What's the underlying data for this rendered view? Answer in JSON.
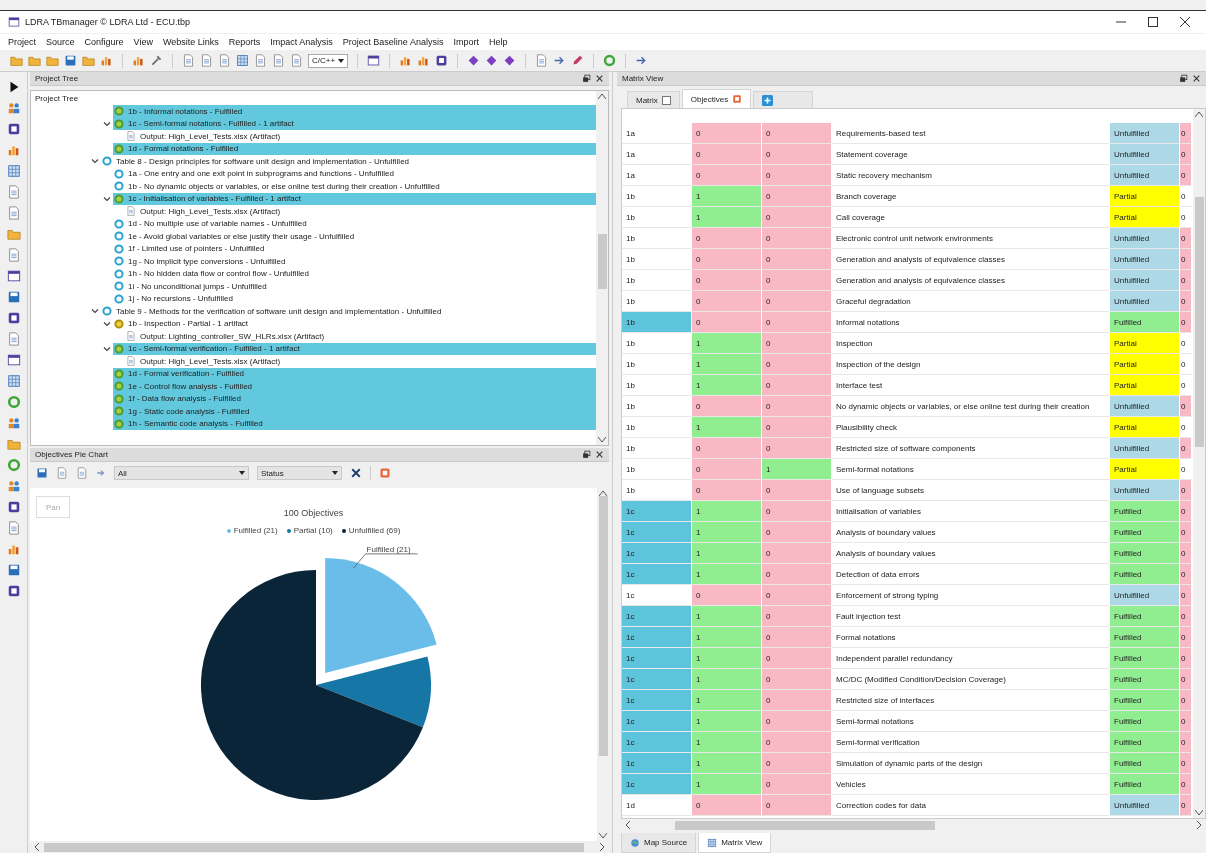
{
  "window": {
    "title": "LDRA TBmanager © LDRA Ltd - ECU.tbp"
  },
  "menu": [
    "Project",
    "Source",
    "Configure",
    "View",
    "Website Links",
    "Reports",
    "Impact Analysis",
    "Project Baseline Analysis",
    "Import",
    "Help"
  ],
  "toolbar": {
    "language": "C/C++"
  },
  "project_tree": {
    "title": "Project Tree",
    "column": "Project Tree",
    "items": [
      {
        "children": [
          {
            "label": "1b - Informal notations  - Fulfilled",
            "kind": "fulfilled",
            "selected": true
          },
          {
            "label": "1c - Semi-formal notations  - Fulfilled - 1 artifact",
            "kind": "fulfilled",
            "selected": true,
            "expanded": true,
            "children": [
              {
                "label": "Output: High_Level_Tests.xlsx (Artifact)",
                "kind": "artifact",
                "selected": false
              }
            ]
          },
          {
            "label": "1d - Formal notations  - Fulfilled",
            "kind": "fulfilled",
            "selected": true
          }
        ]
      },
      {
        "label": "Table 8 - Design principles for software unit design and implementation - Unfulfilled",
        "kind": "unfulfilled",
        "selected": false,
        "expanded": true,
        "children": [
          {
            "label": "1a - One entry and one exit point in subprograms and functions - Unfulfilled",
            "kind": "unfulfilled",
            "selected": false
          },
          {
            "label": "1b - No dynamic objects or variables, or else online test during their creation - Unfulfilled",
            "kind": "unfulfilled",
            "selected": false
          },
          {
            "label": "1c -  Initialisation of variables - Fulfilled - 1 artifact",
            "kind": "fulfilled",
            "selected": true,
            "expanded": true,
            "children": [
              {
                "label": "Output: High_Level_Tests.xlsx (Artifact)",
                "kind": "artifact",
                "selected": false
              }
            ]
          },
          {
            "label": "1d - No multiple use of variable names - Unfulfilled",
            "kind": "unfulfilled",
            "selected": false
          },
          {
            "label": "1e - Avoid global variables or else justify their usage - Unfulfilled",
            "kind": "unfulfilled",
            "selected": false
          },
          {
            "label": "1f - Limited use of pointers - Unfulfilled",
            "kind": "unfulfilled",
            "selected": false
          },
          {
            "label": "1g - No implicit type conversions - Unfulfilled",
            "kind": "unfulfilled",
            "selected": false
          },
          {
            "label": "1h - No hidden data flow or control flow - Unfulfilled",
            "kind": "unfulfilled",
            "selected": false
          },
          {
            "label": "1i - No unconditional jumps - Unfulfilled",
            "kind": "unfulfilled",
            "selected": false
          },
          {
            "label": "1j - No recursions - Unfulfilled",
            "kind": "unfulfilled",
            "selected": false
          }
        ]
      },
      {
        "label": "Table 9 -  Methods for the verification of software unit design and implementation - Unfulfilled",
        "kind": "unfulfilled",
        "selected": false,
        "expanded": true,
        "children": [
          {
            "label": "1b - Inspection - Partial - 1 artifact",
            "kind": "partial",
            "selected": false,
            "expanded": true,
            "children": [
              {
                "label": "Output: Lighting_controller_SW_HLRs.xlsx (Artifact)",
                "kind": "artifact",
                "selected": false
              }
            ]
          },
          {
            "label": "1c - Semi-formal verification - Fulfilled - 1 artifact",
            "kind": "fulfilled",
            "selected": true,
            "expanded": true,
            "children": [
              {
                "label": "Output: High_Level_Tests.xlsx (Artifact)",
                "kind": "artifact",
                "selected": false
              }
            ]
          },
          {
            "label": "1d - Formal verification  - Fulfilled",
            "kind": "fulfilled",
            "selected": true
          },
          {
            "label": "1e - Control flow analysis  - Fulfilled",
            "kind": "fulfilled",
            "selected": true
          },
          {
            "label": "1f - Data flow analysis  - Fulfilled",
            "kind": "fulfilled",
            "selected": true
          },
          {
            "label": "1g - Static code analysis - Fulfilled",
            "kind": "fulfilled",
            "selected": true
          },
          {
            "label": "1h - Semantic code analysis - Fulfilled",
            "kind": "fulfilled",
            "selected": true
          }
        ]
      }
    ]
  },
  "pie_chart_panel": {
    "title": "Objectives Pie Chart",
    "filters": [
      {
        "value": "All"
      },
      {
        "value": "Status"
      }
    ],
    "pan_button": "Pan",
    "legend": [
      {
        "color": "#6bbde9"
      },
      {
        "color": "#1677a6"
      },
      {
        "color": "#0b2538"
      }
    ],
    "chart_data": {
      "type": "pie",
      "title": "100 Objectives",
      "categories": [
        "Fulfilled (21)",
        "Partial (10)",
        "Unfulfilled (69)"
      ],
      "values": [
        21,
        10,
        69
      ],
      "annotations": [
        {
          "text": "Fulfilled (21)"
        }
      ]
    }
  },
  "matrix_view": {
    "title": "Matrix View",
    "tabs": [
      {
        "kind": "view",
        "label": "Matrix",
        "selected": false
      },
      {
        "kind": "view",
        "label": "Objectives",
        "selected": true
      },
      {
        "kind": "add",
        "selected": false
      }
    ],
    "rows": [
      {
        "id": "1a",
        "highlighted": false,
        "column_2": "0",
        "column_2_met": false,
        "column_3": "0",
        "column_3_met": false,
        "objective": "Requirements-based test",
        "status": "Unfulfilled",
        "kind": "unfulfilled",
        "column_6": "0"
      },
      {
        "id": "1a",
        "highlighted": false,
        "column_2": "0",
        "column_2_met": false,
        "column_3": "0",
        "column_3_met": false,
        "objective": "Statement coverage",
        "status": "Unfulfilled",
        "kind": "unfulfilled",
        "column_6": "0"
      },
      {
        "id": "1a",
        "highlighted": false,
        "column_2": "0",
        "column_2_met": false,
        "column_3": "0",
        "column_3_met": false,
        "objective": "Static recovery mechanism",
        "status": "Unfulfilled",
        "kind": "unfulfilled",
        "column_6": "0"
      },
      {
        "id": "1b",
        "highlighted": false,
        "column_2": "1",
        "column_2_met": true,
        "column_3": "0",
        "column_3_met": false,
        "objective": "Branch coverage",
        "status": "Partial",
        "kind": "partial",
        "column_6": "0"
      },
      {
        "id": "1b",
        "highlighted": false,
        "column_2": "1",
        "column_2_met": true,
        "column_3": "0",
        "column_3_met": false,
        "objective": "Call coverage",
        "status": "Partial",
        "kind": "partial",
        "column_6": "0"
      },
      {
        "id": "1b",
        "highlighted": false,
        "column_2": "0",
        "column_2_met": false,
        "column_3": "0",
        "column_3_met": false,
        "objective": "Electronic control unit network environments",
        "status": "Unfulfilled",
        "kind": "unfulfilled",
        "column_6": "0"
      },
      {
        "id": "1b",
        "highlighted": false,
        "column_2": "0",
        "column_2_met": false,
        "column_3": "0",
        "column_3_met": false,
        "objective": "Generation and analysis of equivalence classes",
        "status": "Unfulfilled",
        "kind": "unfulfilled",
        "column_6": "0"
      },
      {
        "id": "1b",
        "highlighted": false,
        "column_2": "0",
        "column_2_met": false,
        "column_3": "0",
        "column_3_met": false,
        "objective": "Generation and analysis of equivalence classes",
        "status": "Unfulfilled",
        "kind": "unfulfilled",
        "column_6": "0"
      },
      {
        "id": "1b",
        "highlighted": false,
        "column_2": "0",
        "column_2_met": false,
        "column_3": "0",
        "column_3_met": false,
        "objective": "Graceful degradation",
        "status": "Unfulfilled",
        "kind": "unfulfilled",
        "column_6": "0"
      },
      {
        "id": "1b",
        "highlighted": true,
        "column_2": "0",
        "column_2_met": false,
        "column_3": "0",
        "column_3_met": false,
        "objective": "Informal notations",
        "status": "Fulfilled",
        "kind": "fulfilled",
        "column_6": "0"
      },
      {
        "id": "1b",
        "highlighted": false,
        "column_2": "1",
        "column_2_met": true,
        "column_3": "0",
        "column_3_met": false,
        "objective": "Inspection",
        "status": "Partial",
        "kind": "partial",
        "column_6": "0"
      },
      {
        "id": "1b",
        "highlighted": false,
        "column_2": "1",
        "column_2_met": true,
        "column_3": "0",
        "column_3_met": false,
        "objective": "Inspection of the design",
        "status": "Partial",
        "kind": "partial",
        "column_6": "0"
      },
      {
        "id": "1b",
        "highlighted": false,
        "column_2": "1",
        "column_2_met": true,
        "column_3": "0",
        "column_3_met": false,
        "objective": "Interface test",
        "status": "Partial",
        "kind": "partial",
        "column_6": "0"
      },
      {
        "id": "1b",
        "highlighted": false,
        "column_2": "0",
        "column_2_met": false,
        "column_3": "0",
        "column_3_met": false,
        "objective": "No dynamic objects or variables, or else online test during their creation",
        "status": "Unfulfilled",
        "kind": "unfulfilled",
        "column_6": "0"
      },
      {
        "id": "1b",
        "highlighted": false,
        "column_2": "1",
        "column_2_met": true,
        "column_3": "0",
        "column_3_met": false,
        "objective": "Plausibility check",
        "status": "Partial",
        "kind": "partial",
        "column_6": "0"
      },
      {
        "id": "1b",
        "highlighted": false,
        "column_2": "0",
        "column_2_met": false,
        "column_3": "0",
        "column_3_met": false,
        "objective": "Restricted size of software components",
        "status": "Unfulfilled",
        "kind": "unfulfilled",
        "column_6": "0"
      },
      {
        "id": "1b",
        "highlighted": false,
        "column_2": "0",
        "column_2_met": false,
        "column_3": "1",
        "column_3_met": true,
        "objective": "Semi-formal notations",
        "status": "Partial",
        "kind": "partial",
        "column_6": "0"
      },
      {
        "id": "1b",
        "highlighted": false,
        "column_2": "0",
        "column_2_met": false,
        "column_3": "0",
        "column_3_met": false,
        "objective": "Use of language subsets",
        "status": "Unfulfilled",
        "kind": "unfulfilled",
        "column_6": "0"
      },
      {
        "id": "1c",
        "highlighted": true,
        "column_2": "1",
        "column_2_met": true,
        "column_3": "0",
        "column_3_met": false,
        "objective": "Initialisation of variables",
        "status": "Fulfilled",
        "kind": "fulfilled",
        "column_6": "0"
      },
      {
        "id": "1c",
        "highlighted": true,
        "column_2": "1",
        "column_2_met": true,
        "column_3": "0",
        "column_3_met": false,
        "objective": "Analysis of boundary values",
        "status": "Fulfilled",
        "kind": "fulfilled",
        "column_6": "0"
      },
      {
        "id": "1c",
        "highlighted": true,
        "column_2": "1",
        "column_2_met": true,
        "column_3": "0",
        "column_3_met": false,
        "objective": "Analysis of boundary values",
        "status": "Fulfilled",
        "kind": "fulfilled",
        "column_6": "0"
      },
      {
        "id": "1c",
        "highlighted": true,
        "column_2": "1",
        "column_2_met": true,
        "column_3": "0",
        "column_3_met": false,
        "objective": "Detection of data errors",
        "status": "Fulfilled",
        "kind": "fulfilled",
        "column_6": "0"
      },
      {
        "id": "1c",
        "highlighted": false,
        "column_2": "0",
        "column_2_met": false,
        "column_3": "0",
        "column_3_met": false,
        "objective": "Enforcement of strong typing",
        "status": "Unfulfilled",
        "kind": "unfulfilled",
        "column_6": "0"
      },
      {
        "id": "1c",
        "highlighted": true,
        "column_2": "1",
        "column_2_met": true,
        "column_3": "0",
        "column_3_met": false,
        "objective": "Fault injection test",
        "status": "Fulfilled",
        "kind": "fulfilled",
        "column_6": "0"
      },
      {
        "id": "1c",
        "highlighted": true,
        "column_2": "1",
        "column_2_met": true,
        "column_3": "0",
        "column_3_met": false,
        "objective": "Formal notations",
        "status": "Fulfilled",
        "kind": "fulfilled",
        "column_6": "0"
      },
      {
        "id": "1c",
        "highlighted": true,
        "column_2": "1",
        "column_2_met": true,
        "column_3": "0",
        "column_3_met": false,
        "objective": "Independent parallel redundancy",
        "status": "Fulfilled",
        "kind": "fulfilled",
        "column_6": "0"
      },
      {
        "id": "1c",
        "highlighted": true,
        "column_2": "1",
        "column_2_met": true,
        "column_3": "0",
        "column_3_met": false,
        "objective": "MC/DC (Modified Condition/Decision Coverage)",
        "status": "Fulfilled",
        "kind": "fulfilled",
        "column_6": "0"
      },
      {
        "id": "1c",
        "highlighted": true,
        "column_2": "1",
        "column_2_met": true,
        "column_3": "0",
        "column_3_met": false,
        "objective": "Restricted size of interfaces",
        "status": "Fulfilled",
        "kind": "fulfilled",
        "column_6": "0"
      },
      {
        "id": "1c",
        "highlighted": true,
        "column_2": "1",
        "column_2_met": true,
        "column_3": "0",
        "column_3_met": false,
        "objective": "Semi-formal notations",
        "status": "Fulfilled",
        "kind": "fulfilled",
        "column_6": "0"
      },
      {
        "id": "1c",
        "highlighted": true,
        "column_2": "1",
        "column_2_met": true,
        "column_3": "0",
        "column_3_met": false,
        "objective": "Semi-formal verification",
        "status": "Fulfilled",
        "kind": "fulfilled",
        "column_6": "0"
      },
      {
        "id": "1c",
        "highlighted": true,
        "column_2": "1",
        "column_2_met": true,
        "column_3": "0",
        "column_3_met": false,
        "objective": "Simulation of dynamic parts of the design",
        "status": "Fulfilled",
        "kind": "fulfilled",
        "column_6": "0"
      },
      {
        "id": "1c",
        "highlighted": true,
        "column_2": "1",
        "column_2_met": true,
        "column_3": "0",
        "column_3_met": false,
        "objective": "Vehicles",
        "status": "Fulfilled",
        "kind": "fulfilled",
        "column_6": "0"
      },
      {
        "id": "1d",
        "highlighted": false,
        "column_2": "0",
        "column_2_met": false,
        "column_3": "0",
        "column_3_met": false,
        "objective": "Correction codes for data",
        "status": "Unfulfilled",
        "kind": "unfulfilled",
        "column_6": "0"
      }
    ]
  },
  "bottom_tabs": [
    {
      "label": "Map Source",
      "selected": false
    },
    {
      "label": "Matrix View",
      "selected": true
    }
  ]
}
